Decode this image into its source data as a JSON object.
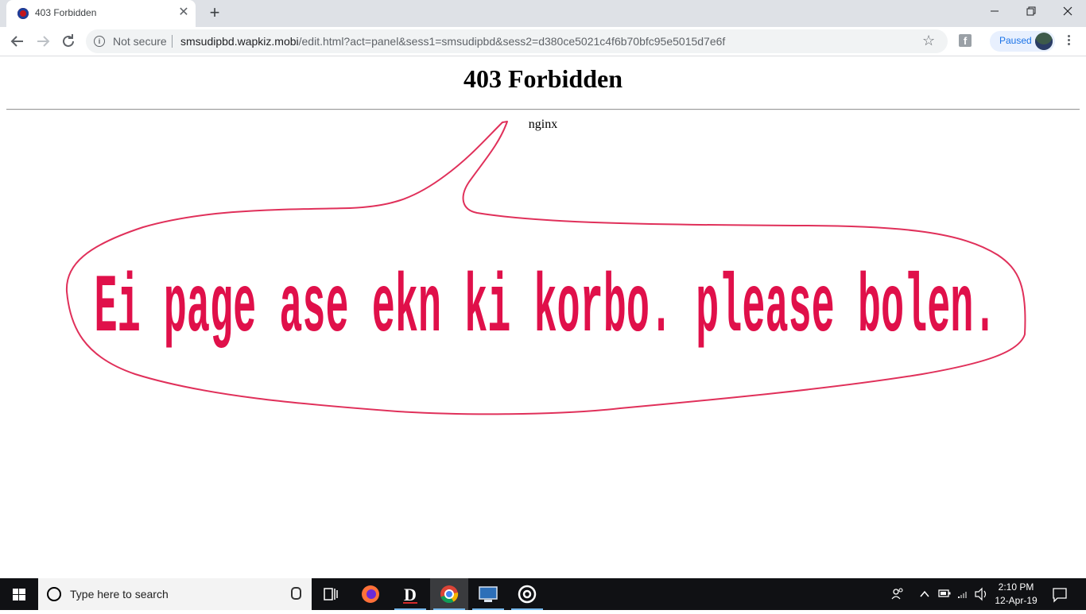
{
  "browser": {
    "tab_title": "403 Forbidden",
    "close_glyph": "✕",
    "newtab_glyph": "+",
    "security_label": "Not secure",
    "url_host": "smsudipbd.wapkiz.mobi",
    "url_path": "/edit.html?act=panel&sess1=smsudipbd&sess2=d380ce5021c4f6b70bfc95e5015d7e6f",
    "profile_label": "Paused",
    "minimize_glyph": "—",
    "maximize_glyph": "❐",
    "close_window_glyph": "✕",
    "bookmark_glyph": "☆",
    "fb_glyph": "f"
  },
  "page": {
    "title": "403 Forbidden",
    "server": "nginx",
    "annotation_text": "Ei page ase ekn ki korbo. please bolen.",
    "annotation_color": "#e0104a"
  },
  "taskbar": {
    "search_placeholder": "Type here to search",
    "time": "2:10 PM",
    "date": "12-Apr-19"
  }
}
